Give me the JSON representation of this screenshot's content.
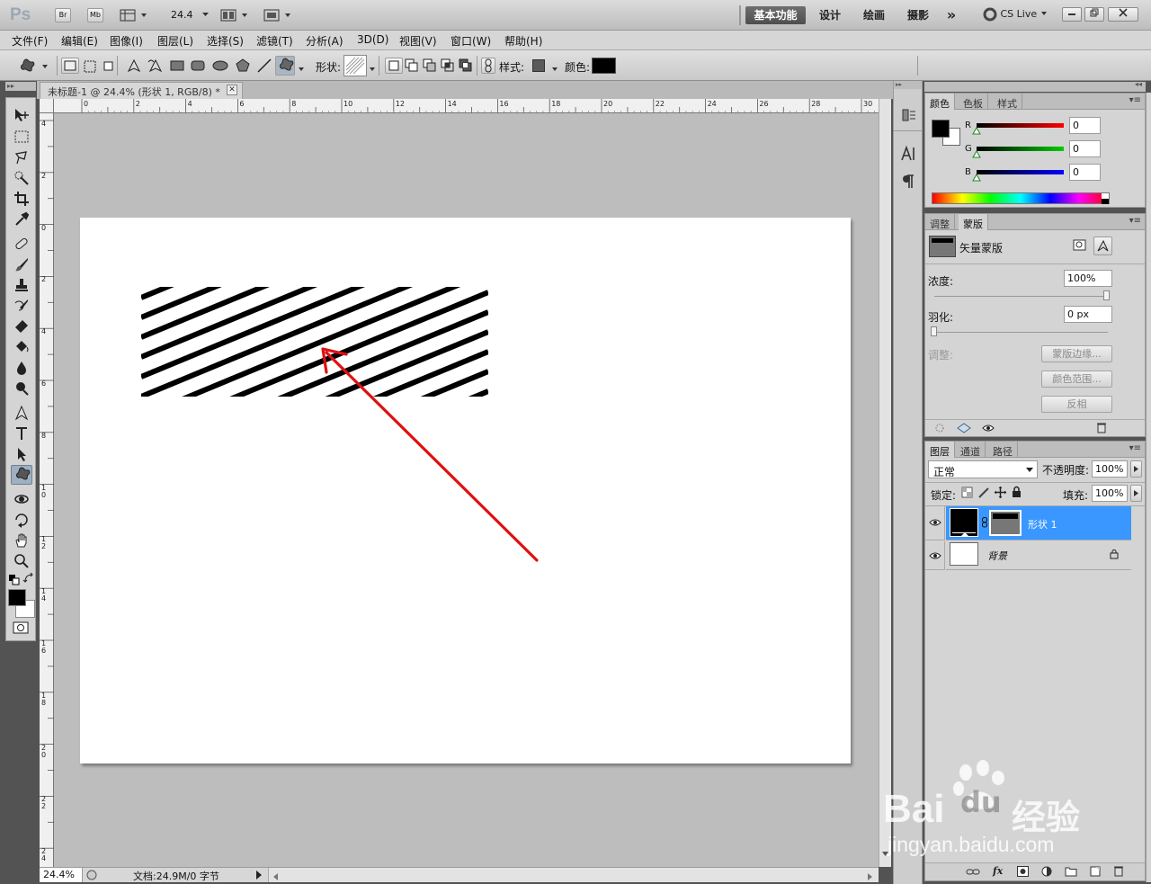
{
  "app": {
    "logo": "Ps",
    "br": "Br",
    "mb": "Mb",
    "zoom": "24.4"
  },
  "workspaces": {
    "essentials": "基本功能",
    "design": "设计",
    "painting": "绘画",
    "photography": "摄影",
    "more": "»",
    "cslive": "CS Live"
  },
  "menu": [
    "文件(F)",
    "编辑(E)",
    "图像(I)",
    "图层(L)",
    "选择(S)",
    "滤镜(T)",
    "分析(A)",
    "3D(D)",
    "视图(V)",
    "窗口(W)",
    "帮助(H)"
  ],
  "options": {
    "shape_label": "形状:",
    "style_label": "样式:",
    "color_label": "颜色:"
  },
  "document": {
    "tab_title": "未标题-1 @ 24.4% (形状 1, RGB/8) *",
    "close": "✕"
  },
  "ruler": {
    "h_labels": [
      "0",
      "2",
      "4",
      "6",
      "8",
      "10",
      "12",
      "14",
      "16",
      "18",
      "20",
      "22",
      "24",
      "26",
      "28",
      "30"
    ],
    "v_labels": [
      "4",
      "2",
      "0",
      "2",
      "4",
      "6",
      "8",
      "1\n0",
      "1\n2",
      "1\n4",
      "1\n6",
      "1\n8",
      "2\n0",
      "2\n2",
      "2\n4"
    ]
  },
  "status": {
    "zoom": "24.4%",
    "doc": "文档:24.9M/0 字节"
  },
  "color_panel": {
    "tabs": [
      "颜色",
      "色板",
      "样式"
    ],
    "r_label": "R",
    "r_value": "0",
    "g_label": "G",
    "g_value": "0",
    "b_label": "B",
    "b_value": "0"
  },
  "masks_panel": {
    "tabs": [
      "调整",
      "蒙版"
    ],
    "mask_type": "矢量蒙版",
    "density_label": "浓度:",
    "density_value": "100%",
    "feather_label": "羽化:",
    "feather_value": "0 px",
    "refine_label": "调整:",
    "mask_edge": "蒙版边缘...",
    "color_range": "颜色范围...",
    "invert": "反相"
  },
  "layers_panel": {
    "tabs": [
      "图层",
      "通道",
      "路径"
    ],
    "blend_mode": "正常",
    "opacity_label": "不透明度:",
    "opacity_value": "100%",
    "lock_label": "锁定:",
    "fill_label": "填充:",
    "fill_value": "100%",
    "layers": [
      {
        "name": "形状 1"
      },
      {
        "name": "背景"
      }
    ]
  },
  "watermark": {
    "brand": "Bai",
    "brand2": "du",
    "cn": "经验",
    "url": "jingyan.baidu.com"
  },
  "colors": {
    "accent_selected_layer": "#3a97ff",
    "arrow": "#e01010",
    "foreground": "#000000",
    "background": "#ffffff"
  }
}
